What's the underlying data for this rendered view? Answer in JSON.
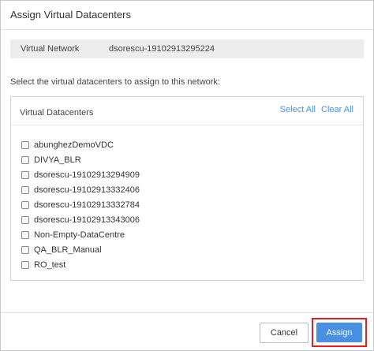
{
  "dialog": {
    "title": "Assign Virtual Datacenters"
  },
  "network": {
    "label": "Virtual Network",
    "value": "dsorescu-19102913295224"
  },
  "instruction": "Select the virtual datacenters to assign to this network:",
  "datacenters": {
    "title": "Virtual Datacenters",
    "select_all": "Select All",
    "clear_all": "Clear All",
    "items": [
      {
        "label": "abunghezDemoVDC",
        "checked": false
      },
      {
        "label": "DIVYA_BLR",
        "checked": false
      },
      {
        "label": "dsorescu-19102913294909",
        "checked": false
      },
      {
        "label": "dsorescu-19102913332406",
        "checked": false
      },
      {
        "label": "dsorescu-19102913332784",
        "checked": false
      },
      {
        "label": "dsorescu-19102913343006",
        "checked": false
      },
      {
        "label": "Non-Empty-DataCentre",
        "checked": false
      },
      {
        "label": "QA_BLR_Manual",
        "checked": false
      },
      {
        "label": "RO_test",
        "checked": false
      }
    ]
  },
  "buttons": {
    "cancel": "Cancel",
    "assign": "Assign"
  },
  "colors": {
    "accent": "#4a90e2",
    "link": "#4a90d9",
    "highlight": "#e02020"
  }
}
